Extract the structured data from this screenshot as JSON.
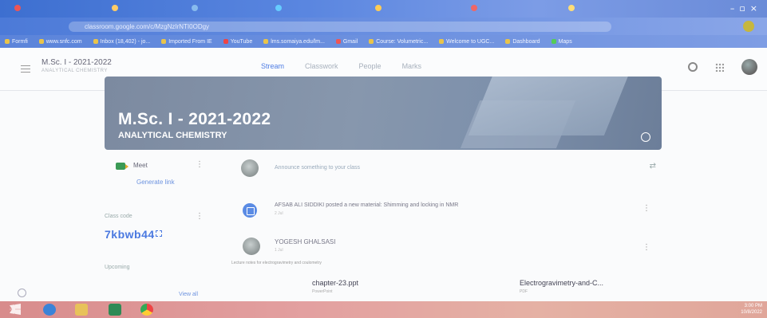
{
  "browser": {
    "url": "classroom.google.com/c/MzgNzIrNTI0ODgy",
    "bookmarks": [
      "Formfi",
      "www.snfc.com",
      "Inbox (18,402) - jo...",
      "Imported From IE",
      "YouTube",
      "lms.somaiya.edu/lm...",
      "Gmail",
      "Course: Volumetric...",
      "Welcome to UGC...",
      "Dashboard",
      "Maps"
    ]
  },
  "header": {
    "course_title": "M.Sc. I - 2021-2022",
    "course_subtitle": "ANALYTICAL CHEMISTRY",
    "tabs": [
      {
        "label": "Stream",
        "active": true
      },
      {
        "label": "Classwork",
        "active": false
      },
      {
        "label": "People",
        "active": false
      },
      {
        "label": "Marks",
        "active": false
      }
    ]
  },
  "banner": {
    "title": "M.Sc. I - 2021-2022",
    "subtitle": "ANALYTICAL CHEMISTRY"
  },
  "sidebar": {
    "meet_label": "Meet",
    "generate_link": "Generate link",
    "class_code_label": "Class code",
    "class_code": "7kbwb44",
    "upcoming_label": "Upcoming",
    "view_all": "View all"
  },
  "stream": {
    "announce_placeholder": "Announce something to your class",
    "posts": [
      {
        "author_text": "AFSAB ALI SIDDIKI posted a new material: Shimming and locking in NMR",
        "time": "2 Jul"
      },
      {
        "author": "YOGESH GHALSASI",
        "time": "1 Jul",
        "note": "Lecture notes for electrogravimetry and coulometry",
        "attachments": [
          {
            "name": "chapter-23.ppt",
            "type": "PowerPoint"
          },
          {
            "name": "Electrogravimetry-and-C...",
            "type": "PDF"
          }
        ]
      }
    ]
  },
  "taskbar": {
    "time": "3:00 PM",
    "date": "10/8/2022"
  },
  "colors": {
    "accent": "#4f7de4",
    "banner": "#8393a9",
    "taskbar": "#de9a98"
  }
}
